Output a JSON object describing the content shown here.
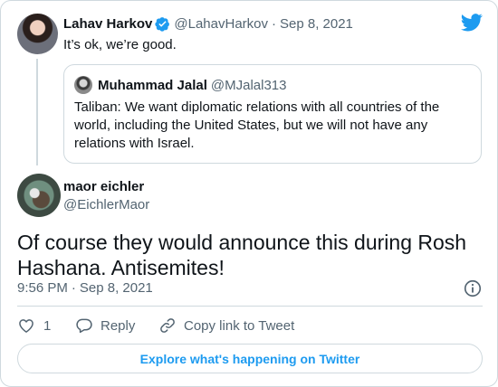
{
  "parent_tweet": {
    "author_name": "Lahav Harkov",
    "handle": "@LahavHarkov",
    "separator": "·",
    "date": "Sep 8, 2021",
    "text": "It’s ok, we’re good.",
    "verified": true
  },
  "quoted_tweet": {
    "author_name": "Muhammad Jalal",
    "handle": "@MJalal313",
    "text": "Taliban: We want diplomatic relations with all countries of the world, including the United States, but we will not have any relations with Israel."
  },
  "main_tweet": {
    "author_name": "maor eichler",
    "handle": "@EichlerMaor",
    "text": "Of course they would announce this during Rosh Hashana. Antisemites!",
    "time": "9:56 PM",
    "separator": "·",
    "date": "Sep 8, 2021"
  },
  "actions": {
    "like_count": "1",
    "reply_label": "Reply",
    "copy_link_label": "Copy link to Tweet"
  },
  "explore_label": "Explore what's happening on Twitter",
  "icons": {
    "brand": "twitter-bird-icon",
    "verified": "verified-badge-icon",
    "info": "info-icon",
    "like": "heart-icon",
    "reply": "reply-bubble-icon",
    "copy_link": "link-icon"
  },
  "colors": {
    "twitter_blue": "#1d9bf0",
    "text_primary": "#0f1419",
    "text_secondary": "#536471",
    "border": "#cfd9de"
  }
}
